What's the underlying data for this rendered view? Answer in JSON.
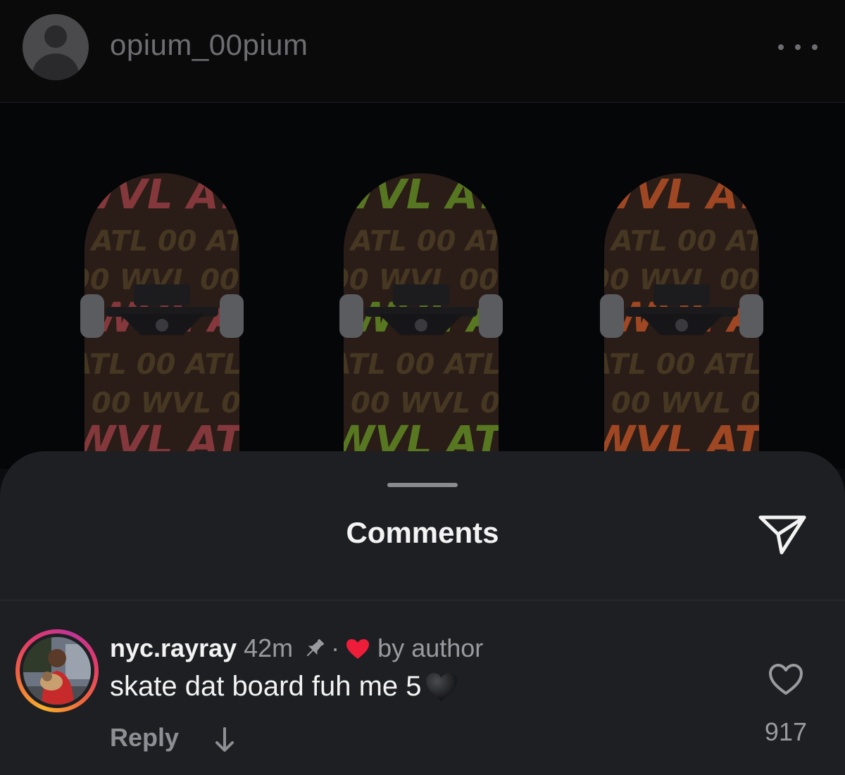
{
  "post": {
    "username": "opium_00pium",
    "image": {
      "boards": [
        {
          "color": "#8a3a3e",
          "tags": [
            "WVL",
            "ATL",
            "00"
          ]
        },
        {
          "color": "#5a7c22",
          "tags": [
            "WVL",
            "ATL",
            "00"
          ]
        },
        {
          "color": "#a64a24",
          "tags": [
            "WVL",
            "ATL",
            "00"
          ]
        }
      ]
    }
  },
  "comments_sheet": {
    "title": "Comments",
    "comment": {
      "username": "nyc.rayray",
      "time": "42m",
      "separator": "·",
      "liked_by": "by author",
      "text": "skate dat board fuh me 5",
      "reply_label": "Reply",
      "like_count": "917"
    }
  },
  "icons": {
    "more": "more-horizontal-icon",
    "share": "paper-plane-icon",
    "pin": "pin-icon",
    "liked": "red-heart-icon",
    "emoji": "black-heart-icon",
    "expand": "arrow-down-icon",
    "like": "heart-outline-icon"
  },
  "colors": {
    "sheet_bg": "#1e1f23",
    "heart_red": "#ee1d3a",
    "muted_text": "#9a9ba0"
  }
}
